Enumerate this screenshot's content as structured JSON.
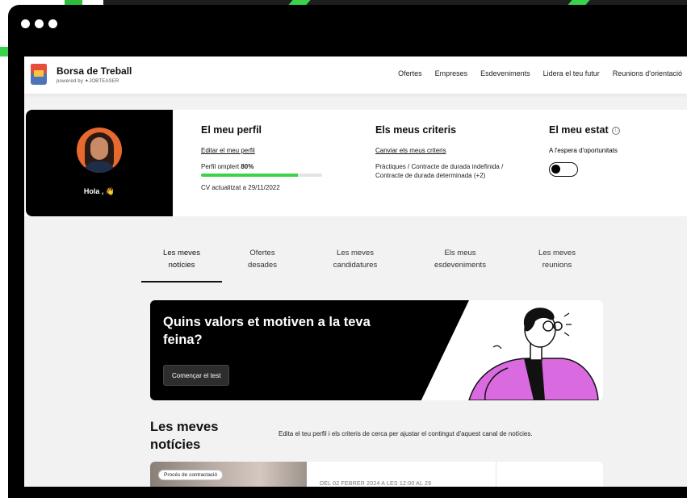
{
  "brand": {
    "title": "Borsa de Treball",
    "subtitle": "powered by ✦JOBTEASER"
  },
  "nav": {
    "items": [
      "Ofertes",
      "Empreses",
      "Esdeveniments",
      "Lidera el teu futur",
      "Reunions d'orientació"
    ]
  },
  "profile": {
    "greeting": "Hola ,",
    "wave_emoji": "👋",
    "my_profile": {
      "title": "El meu perfil",
      "edit_link": "Editar el meu perfil",
      "completion_label_prefix": "Perfil omplert",
      "completion_value": "80%",
      "completion_fraction": 0.8,
      "cv_updated": "CV actualitzat a 29/11/2022"
    },
    "my_criteria": {
      "title": "Els meus criteris",
      "change_link": "Canviar els meus criteris",
      "text": "Pràctiques / Contracte de durada indefinida / Contracte de durada determinada (+2)"
    },
    "my_status": {
      "title": "El meu estat",
      "info_icon": "ⓘ",
      "text": "A l'espera d'oportunitats",
      "toggle_on": false
    }
  },
  "tabs": [
    {
      "line1": "Les meves",
      "line2": "notícies",
      "active": true
    },
    {
      "line1": "Ofertes",
      "line2": "desades",
      "active": false
    },
    {
      "line1": "Les meves",
      "line2": "candidatures",
      "active": false
    },
    {
      "line1": "Els meus",
      "line2": "esdeveniments",
      "active": false
    },
    {
      "line1": "Les meves",
      "line2": "reunions",
      "active": false
    }
  ],
  "banner": {
    "title": "Quins valors et motiven a la teva feina?",
    "button": "Començar el test"
  },
  "news": {
    "title": "Les meves notícies",
    "description": "Edita el teu perfil i els criteris de cerca per ajustar el contingut d'aquest canal de notícies.",
    "card_badge": "Procés de contractació",
    "card_date": "DEL 02 FEBRER 2024 A LES 12:00 AL 29"
  },
  "colors": {
    "accent_green": "#3ad24a",
    "banner_person": "#d96ae0"
  }
}
